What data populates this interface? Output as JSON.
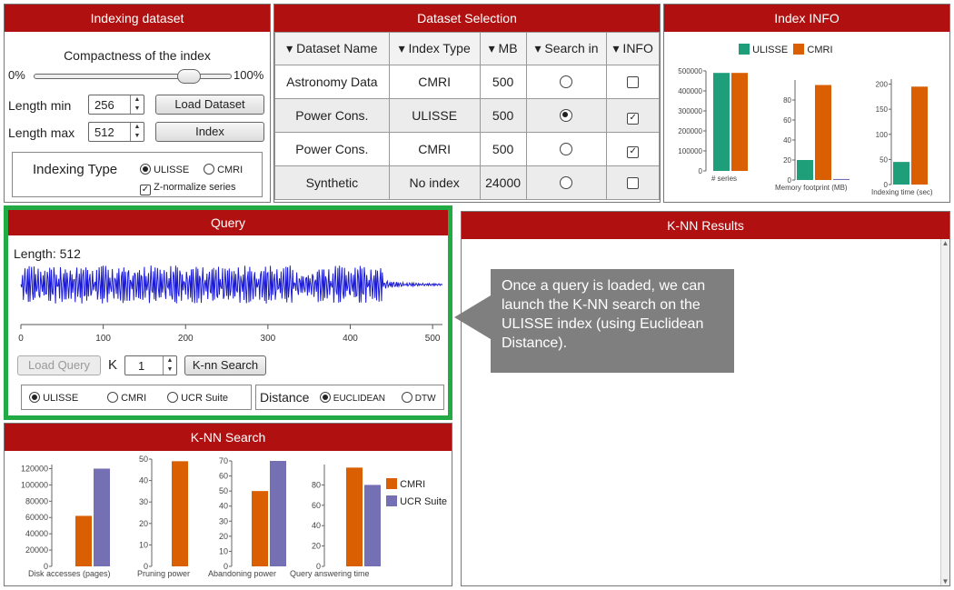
{
  "indexing": {
    "title": "Indexing dataset",
    "compactness_label": "Compactness of the index",
    "slider_min": "0%",
    "slider_max": "100%",
    "slider_fraction": 0.78,
    "length_min_label": "Length min",
    "length_min_value": "256",
    "length_max_label": "Length max",
    "length_max_value": "512",
    "load_dataset_btn": "Load Dataset",
    "index_btn": "Index",
    "indexing_type_label": "Indexing Type",
    "opt_ulisse": "ULISSE",
    "opt_cmri": "CMRI",
    "znorm_label": "Z-normalize series"
  },
  "dataset_selection": {
    "title": "Dataset Selection",
    "headers": [
      "▾ Dataset Name",
      "▾ Index Type",
      "▾ MB",
      "▾ Search in",
      "▾ INFO"
    ],
    "rows": [
      {
        "name": "Astronomy Data",
        "index": "CMRI",
        "mb": "500",
        "search": false,
        "info": false
      },
      {
        "name": "Power Cons.",
        "index": "ULISSE",
        "mb": "500",
        "search": true,
        "info": true
      },
      {
        "name": "Power Cons.",
        "index": "CMRI",
        "mb": "500",
        "search": false,
        "info": true
      },
      {
        "name": "Synthetic",
        "index": "No index",
        "mb": "24000",
        "search": false,
        "info": false
      }
    ]
  },
  "index_info": {
    "title": "Index INFO",
    "legend": [
      "ULISSE",
      "CMRI"
    ],
    "colors": {
      "ulisse": "#1f9e7a",
      "cmri": "#d95f02",
      "ucr": "#7570b3"
    }
  },
  "query": {
    "title": "Query",
    "length_label": "Length: 512",
    "x_ticks": [
      "0",
      "100",
      "200",
      "300",
      "400",
      "500"
    ],
    "load_query_btn": "Load Query",
    "k_label": "K",
    "k_value": "1",
    "knn_search_btn": "K-nn Search",
    "opt_ulisse": "ULISSE",
    "opt_cmri": "CMRI",
    "opt_ucr": "UCR Suite",
    "distance_label": "Distance",
    "opt_euclidean": "EUCLIDEAN",
    "opt_dtw": "DTW"
  },
  "knn_search": {
    "title": "K-NN Search",
    "legend": [
      "CMRI",
      "UCR Suite"
    ]
  },
  "knn_results": {
    "title": "K-NN Results"
  },
  "callout": {
    "text": "Once a query is loaded, we can launch the K-NN search on the ULISSE index (using Euclidean Distance)."
  },
  "chart_data": [
    {
      "type": "bar",
      "categories": [
        "# series"
      ],
      "series": [
        {
          "name": "ULISSE",
          "values": [
            490000
          ]
        },
        {
          "name": "CMRI",
          "values": [
            490000
          ]
        }
      ],
      "ylim": [
        0,
        500000
      ],
      "y_ticks": [
        "0",
        "100000",
        "200000",
        "300000",
        "400000",
        "500000"
      ]
    },
    {
      "type": "bar",
      "categories": [
        "Memory footprint (MB)"
      ],
      "series": [
        {
          "name": "ULISSE",
          "values": [
            20
          ]
        },
        {
          "name": "CMRI",
          "values": [
            95
          ]
        },
        {
          "name": "",
          "values": [
            1
          ]
        }
      ],
      "ylim": [
        0,
        100
      ],
      "y_ticks": [
        "0",
        "20",
        "40",
        "60",
        "80"
      ]
    },
    {
      "type": "bar",
      "categories": [
        "Indexing time (sec)"
      ],
      "series": [
        {
          "name": "ULISSE",
          "values": [
            45
          ]
        },
        {
          "name": "CMRI",
          "values": [
            195
          ]
        }
      ],
      "ylim": [
        0,
        210
      ],
      "y_ticks": [
        "0",
        "50",
        "100",
        "150",
        "200"
      ]
    },
    {
      "type": "bar",
      "categories": [
        "Disk accesses (pages)"
      ],
      "series": [
        {
          "name": "CMRI",
          "values": [
            62000
          ]
        },
        {
          "name": "UCR Suite",
          "values": [
            120000
          ]
        }
      ],
      "ylim": [
        0,
        125000
      ],
      "y_ticks": [
        "0",
        "20000",
        "40000",
        "60000",
        "80000",
        "100000",
        "120000"
      ]
    },
    {
      "type": "bar",
      "categories": [
        "Pruning power"
      ],
      "series": [
        {
          "name": "CMRI",
          "values": [
            49
          ]
        }
      ],
      "ylim": [
        0,
        50
      ],
      "y_ticks": [
        "0",
        "10",
        "20",
        "30",
        "40",
        "50"
      ]
    },
    {
      "type": "bar",
      "categories": [
        "Abandoning power"
      ],
      "series": [
        {
          "name": "CMRI",
          "values": [
            50
          ]
        },
        {
          "name": "UCR Suite",
          "values": [
            70
          ]
        }
      ],
      "ylim": [
        0,
        70
      ],
      "y_ticks": [
        "0",
        "10",
        "20",
        "30",
        "40",
        "50",
        "60",
        "70"
      ]
    },
    {
      "type": "bar",
      "categories": [
        "Query answering time"
      ],
      "series": [
        {
          "name": "CMRI",
          "values": [
            97
          ]
        },
        {
          "name": "UCR Suite",
          "values": [
            80
          ]
        }
      ],
      "ylim": [
        0,
        100
      ],
      "y_ticks": [
        "0",
        "20",
        "40",
        "60",
        "80"
      ]
    }
  ]
}
